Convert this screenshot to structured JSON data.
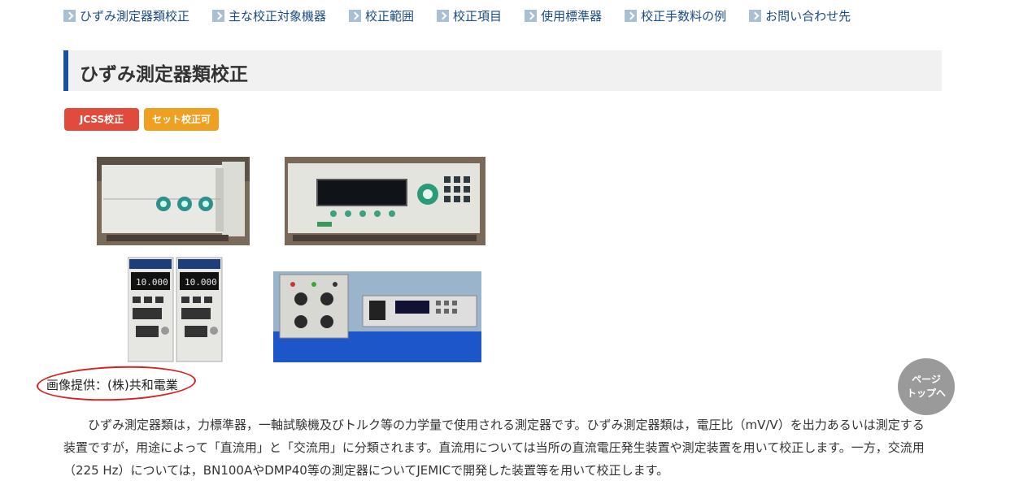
{
  "nav": {
    "items": [
      "ひずみ測定器類校正",
      "主な校正対象機器",
      "校正範囲",
      "校正項目",
      "使用標準器",
      "校正手数料の例",
      "お問い合わせ先"
    ]
  },
  "page": {
    "title": "ひずみ測定器類校正",
    "badges": [
      "JCSS校正",
      "セット校正可"
    ],
    "caption": "画像提供：(株)共和電業",
    "to_top": [
      "ページ",
      "トップへ"
    ],
    "body": "ひずみ測定器類は，力標準器，一軸試験機及びトルク等の力学量で使用される測定器です。ひずみ測定器類は，電圧比（mV/V）を出力あるいは測定する装置ですが，用途によって「直流用」と「交流用」に分類されます。直流用については当所の直流電圧発生装置や測定装置を用いて校正します。一方，交流用（225 Hz）については，BN100AやDMP40等の測定器についてJEMICで開発した装置等を用いて校正します。"
  },
  "images": [
    {
      "name": "strain-gauge-calibrator-device"
    },
    {
      "name": "voltage-ratio-standard-device"
    },
    {
      "name": "dpm-strain-amplifier-modules",
      "labels": [
        "10.000",
        "10.000"
      ]
    },
    {
      "name": "bridge-box-and-meter-set"
    }
  ],
  "colors": {
    "nav_text": "#1a4c86",
    "title_accent": "#1d4f9a",
    "badge_jcss": "#e14b3b",
    "badge_set": "#f0a021",
    "caption_circle": "#d92020"
  }
}
